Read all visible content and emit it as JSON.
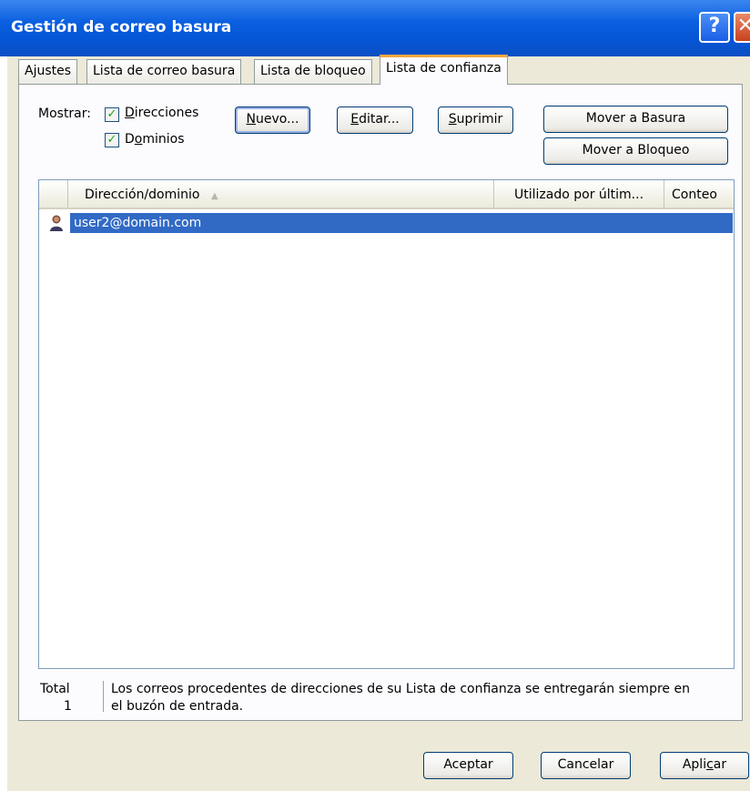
{
  "window": {
    "title": "Gestión de correo basura",
    "help_glyph": "?",
    "close_glyph": "✕"
  },
  "tabs": [
    {
      "label": "Ajustes"
    },
    {
      "label": "Lista de correo basura"
    },
    {
      "label": "Lista de bloqueo"
    },
    {
      "label": "Lista de confianza",
      "active": true
    }
  ],
  "filters": {
    "label": "Mostrar:",
    "addresses_prefix": "",
    "addresses_underline": "D",
    "addresses_rest": "irecciones",
    "addresses_checked": true,
    "domains_prefix": "D",
    "domains_underline": "o",
    "domains_rest": "minios",
    "domains_checked": true
  },
  "actions": {
    "new_u": "N",
    "new_rest": "uevo...",
    "edit_u": "E",
    "edit_rest": "ditar...",
    "delete_u": "S",
    "delete_rest": "uprimir",
    "move_junk": "Mover a Basura",
    "move_block": "Mover a Bloqueo"
  },
  "list": {
    "columns": [
      "Dirección/dominio",
      "Utilizado por últim...",
      "Conteo"
    ],
    "sort_indicator": "▲",
    "rows": [
      {
        "address": "user2@domain.com",
        "icon": "person-icon",
        "selected": true
      }
    ]
  },
  "footer": {
    "total_label": "Total",
    "total_value": "1",
    "note_line1": "Los correos procedentes de direcciones de su Lista de confianza se entregarán siempre en",
    "note_line2": "el buzón de entrada."
  },
  "dialog_buttons": {
    "ok": "Aceptar",
    "cancel": "Cancelar",
    "apply_prefix": "Apli",
    "apply_u": "c",
    "apply_rest": "ar"
  },
  "colors": {
    "titlebar": "#0a5fe0",
    "selection": "#316ac5",
    "dialog_bg": "#ece9d8",
    "check": "#21a121"
  }
}
